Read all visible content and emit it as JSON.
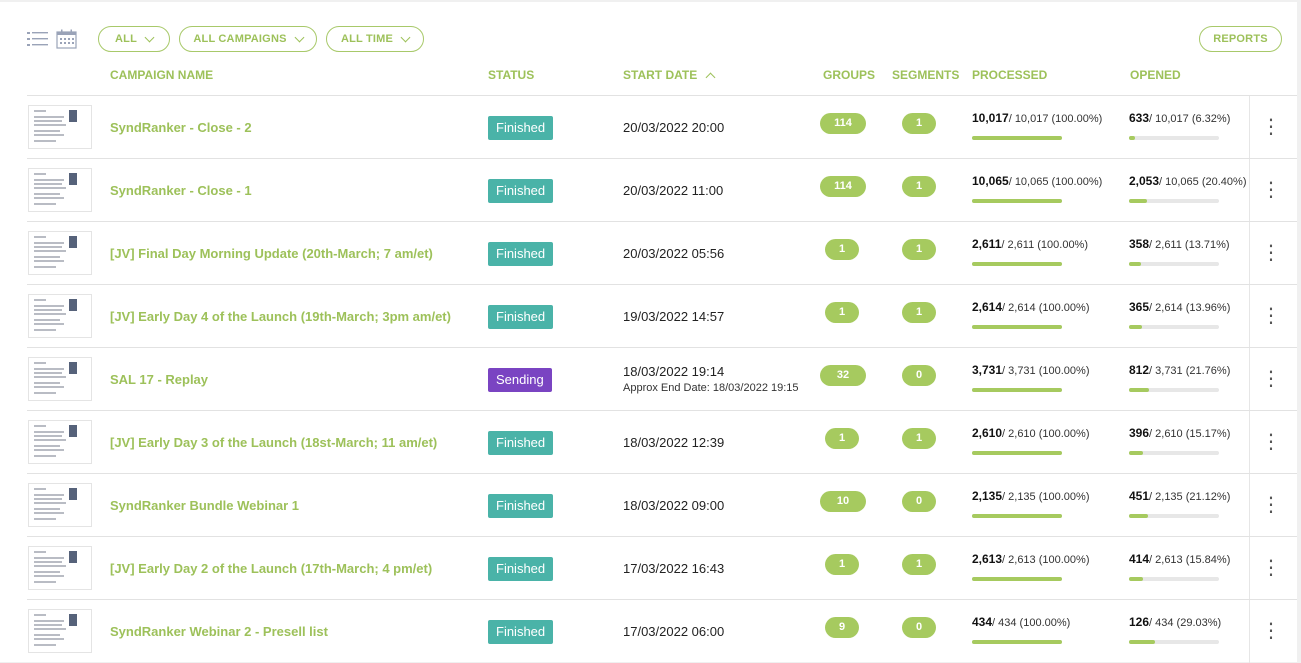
{
  "toolbar": {
    "filter_all": "ALL",
    "filter_campaigns": "ALL CAMPAIGNS",
    "filter_time": "ALL TIME",
    "reports": "REPORTS"
  },
  "columns": {
    "campaign_name": "CAMPAIGN NAME",
    "status": "STATUS",
    "start_date": "START DATE",
    "groups": "GROUPS",
    "segments": "SEGMENTS",
    "processed": "PROCESSED",
    "opened": "OPENED"
  },
  "colors": {
    "accent": "#9dc15a",
    "finished": "#4ab3a8",
    "sending": "#7a44c2"
  },
  "rows": [
    {
      "name": "SyndRanker - Close - 2",
      "status": "Finished",
      "date": "20/03/2022 20:00",
      "approx": "",
      "groups": "114",
      "segments": "1",
      "processed_count": "10,017",
      "processed_rest": "/ 10,017 (100.00%)",
      "processed_pct": 100,
      "opened_count": "633",
      "opened_rest": "/ 10,017 (6.32%)",
      "opened_pct": 6.32
    },
    {
      "name": "SyndRanker - Close - 1",
      "status": "Finished",
      "date": "20/03/2022 11:00",
      "approx": "",
      "groups": "114",
      "segments": "1",
      "processed_count": "10,065",
      "processed_rest": "/ 10,065 (100.00%)",
      "processed_pct": 100,
      "opened_count": "2,053",
      "opened_rest": "/ 10,065 (20.40%)",
      "opened_pct": 20.4
    },
    {
      "name": "[JV] Final Day Morning Update (20th-March; 7 am/et)",
      "status": "Finished",
      "date": "20/03/2022 05:56",
      "approx": "",
      "groups": "1",
      "segments": "1",
      "processed_count": "2,611",
      "processed_rest": "/ 2,611 (100.00%)",
      "processed_pct": 100,
      "opened_count": "358",
      "opened_rest": "/ 2,611 (13.71%)",
      "opened_pct": 13.71
    },
    {
      "name": "[JV] Early Day 4 of the Launch (19th-March; 3pm am/et)",
      "status": "Finished",
      "date": "19/03/2022 14:57",
      "approx": "",
      "groups": "1",
      "segments": "1",
      "processed_count": "2,614",
      "processed_rest": "/ 2,614 (100.00%)",
      "processed_pct": 100,
      "opened_count": "365",
      "opened_rest": "/ 2,614 (13.96%)",
      "opened_pct": 13.96
    },
    {
      "name": "SAL 17 - Replay",
      "status": "Sending",
      "date": "18/03/2022 19:14",
      "approx": "Approx End Date: 18/03/2022 19:15",
      "groups": "32",
      "segments": "0",
      "processed_count": "3,731",
      "processed_rest": "/ 3,731 (100.00%)",
      "processed_pct": 100,
      "opened_count": "812",
      "opened_rest": "/ 3,731 (21.76%)",
      "opened_pct": 21.76
    },
    {
      "name": "[JV] Early Day 3 of the Launch (18st-March; 11 am/et)",
      "status": "Finished",
      "date": "18/03/2022 12:39",
      "approx": "",
      "groups": "1",
      "segments": "1",
      "processed_count": "2,610",
      "processed_rest": "/ 2,610 (100.00%)",
      "processed_pct": 100,
      "opened_count": "396",
      "opened_rest": "/ 2,610 (15.17%)",
      "opened_pct": 15.17
    },
    {
      "name": "SyndRanker Bundle Webinar 1",
      "status": "Finished",
      "date": "18/03/2022 09:00",
      "approx": "",
      "groups": "10",
      "segments": "0",
      "processed_count": "2,135",
      "processed_rest": "/ 2,135 (100.00%)",
      "processed_pct": 100,
      "opened_count": "451",
      "opened_rest": "/ 2,135 (21.12%)",
      "opened_pct": 21.12
    },
    {
      "name": "[JV] Early Day 2 of the Launch (17th-March; 4 pm/et)",
      "status": "Finished",
      "date": "17/03/2022 16:43",
      "approx": "",
      "groups": "1",
      "segments": "1",
      "processed_count": "2,613",
      "processed_rest": "/ 2,613 (100.00%)",
      "processed_pct": 100,
      "opened_count": "414",
      "opened_rest": "/ 2,613 (15.84%)",
      "opened_pct": 15.84
    },
    {
      "name": "SyndRanker Webinar 2 - Presell list",
      "status": "Finished",
      "date": "17/03/2022 06:00",
      "approx": "",
      "groups": "9",
      "segments": "0",
      "processed_count": "434",
      "processed_rest": "/ 434 (100.00%)",
      "processed_pct": 100,
      "opened_count": "126",
      "opened_rest": "/ 434 (29.03%)",
      "opened_pct": 29.03
    }
  ],
  "icons": {
    "list_view": "list-view-icon",
    "calendar_view": "calendar-icon",
    "row_menu": "kebab-menu-icon"
  }
}
